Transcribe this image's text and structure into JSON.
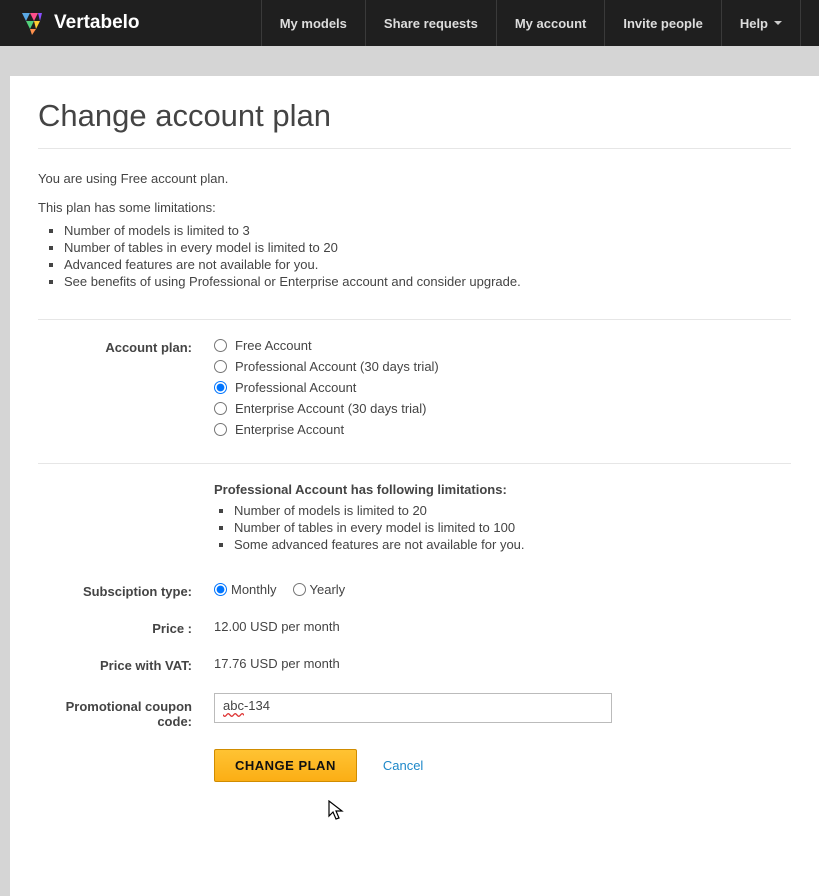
{
  "nav": {
    "brand": "Vertabelo",
    "items": [
      "My models",
      "Share requests",
      "My account",
      "Invite people",
      "Help"
    ]
  },
  "page": {
    "title": "Change account plan",
    "intro": "You are using Free account plan.",
    "limitations_lead": "This plan has some limitations:",
    "limitations": [
      "Number of models is limited to 3",
      "Number of tables in every model is limited to 20",
      "Advanced features are not available for you.",
      "See benefits of using Professional or Enterprise account and consider upgrade."
    ]
  },
  "form": {
    "account_plan_label": "Account plan:",
    "plans": [
      {
        "label": "Free Account",
        "checked": false
      },
      {
        "label": "Professional Account (30 days trial)",
        "checked": false
      },
      {
        "label": "Professional Account",
        "checked": true
      },
      {
        "label": "Enterprise Account (30 days trial)",
        "checked": false
      },
      {
        "label": "Enterprise Account",
        "checked": false
      }
    ],
    "selected_plan_limits_head": "Professional Account has following limitations:",
    "selected_plan_limits": [
      "Number of models is limited to 20",
      "Number of tables in every model is limited to 100",
      "Some advanced features are not available for you."
    ],
    "subscription_label": "Subsciption type:",
    "subscriptions": [
      {
        "label": "Monthly",
        "checked": true
      },
      {
        "label": "Yearly",
        "checked": false
      }
    ],
    "price_label": "Price :",
    "price_value": "12.00 USD per month",
    "price_vat_label": "Price with VAT:",
    "price_vat_value": "17.76 USD per month",
    "coupon_label": "Promotional coupon code:",
    "coupon_value_part1": "abc",
    "coupon_value_part2": "-134",
    "change_btn": "Change plan",
    "cancel": "Cancel"
  }
}
